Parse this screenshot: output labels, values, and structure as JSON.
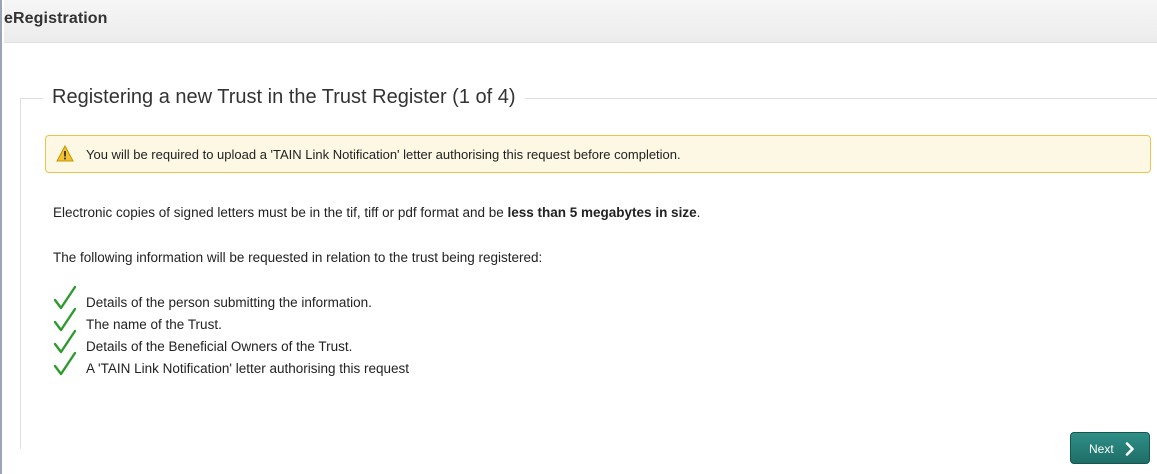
{
  "header": {
    "title": "eRegistration"
  },
  "section": {
    "legend": "Registering a new Trust in the Trust Register (1 of 4)"
  },
  "warning": {
    "icon": "warning-triangle-icon",
    "text": "You will be required to upload a 'TAIN Link Notification' letter authorising this request before completion."
  },
  "info": {
    "format_prefix": "Electronic copies of signed letters must be in the tif, tiff or pdf format and be ",
    "format_bold": "less than 5 megabytes in size",
    "format_suffix": ".",
    "requested_intro": "The following information will be requested in relation to the trust being registered:"
  },
  "checklist": [
    "Details of the person submitting the information.",
    "The name of the Trust.",
    "Details of the Beneficial Owners of the Trust.",
    "A 'TAIN Link Notification' letter authorising this request"
  ],
  "actions": {
    "next_label": "Next"
  },
  "colors": {
    "accent": "#237a72",
    "check": "#2e9b2e",
    "warning_bg": "#fcf8e3",
    "warning_border": "#f0c24b"
  }
}
